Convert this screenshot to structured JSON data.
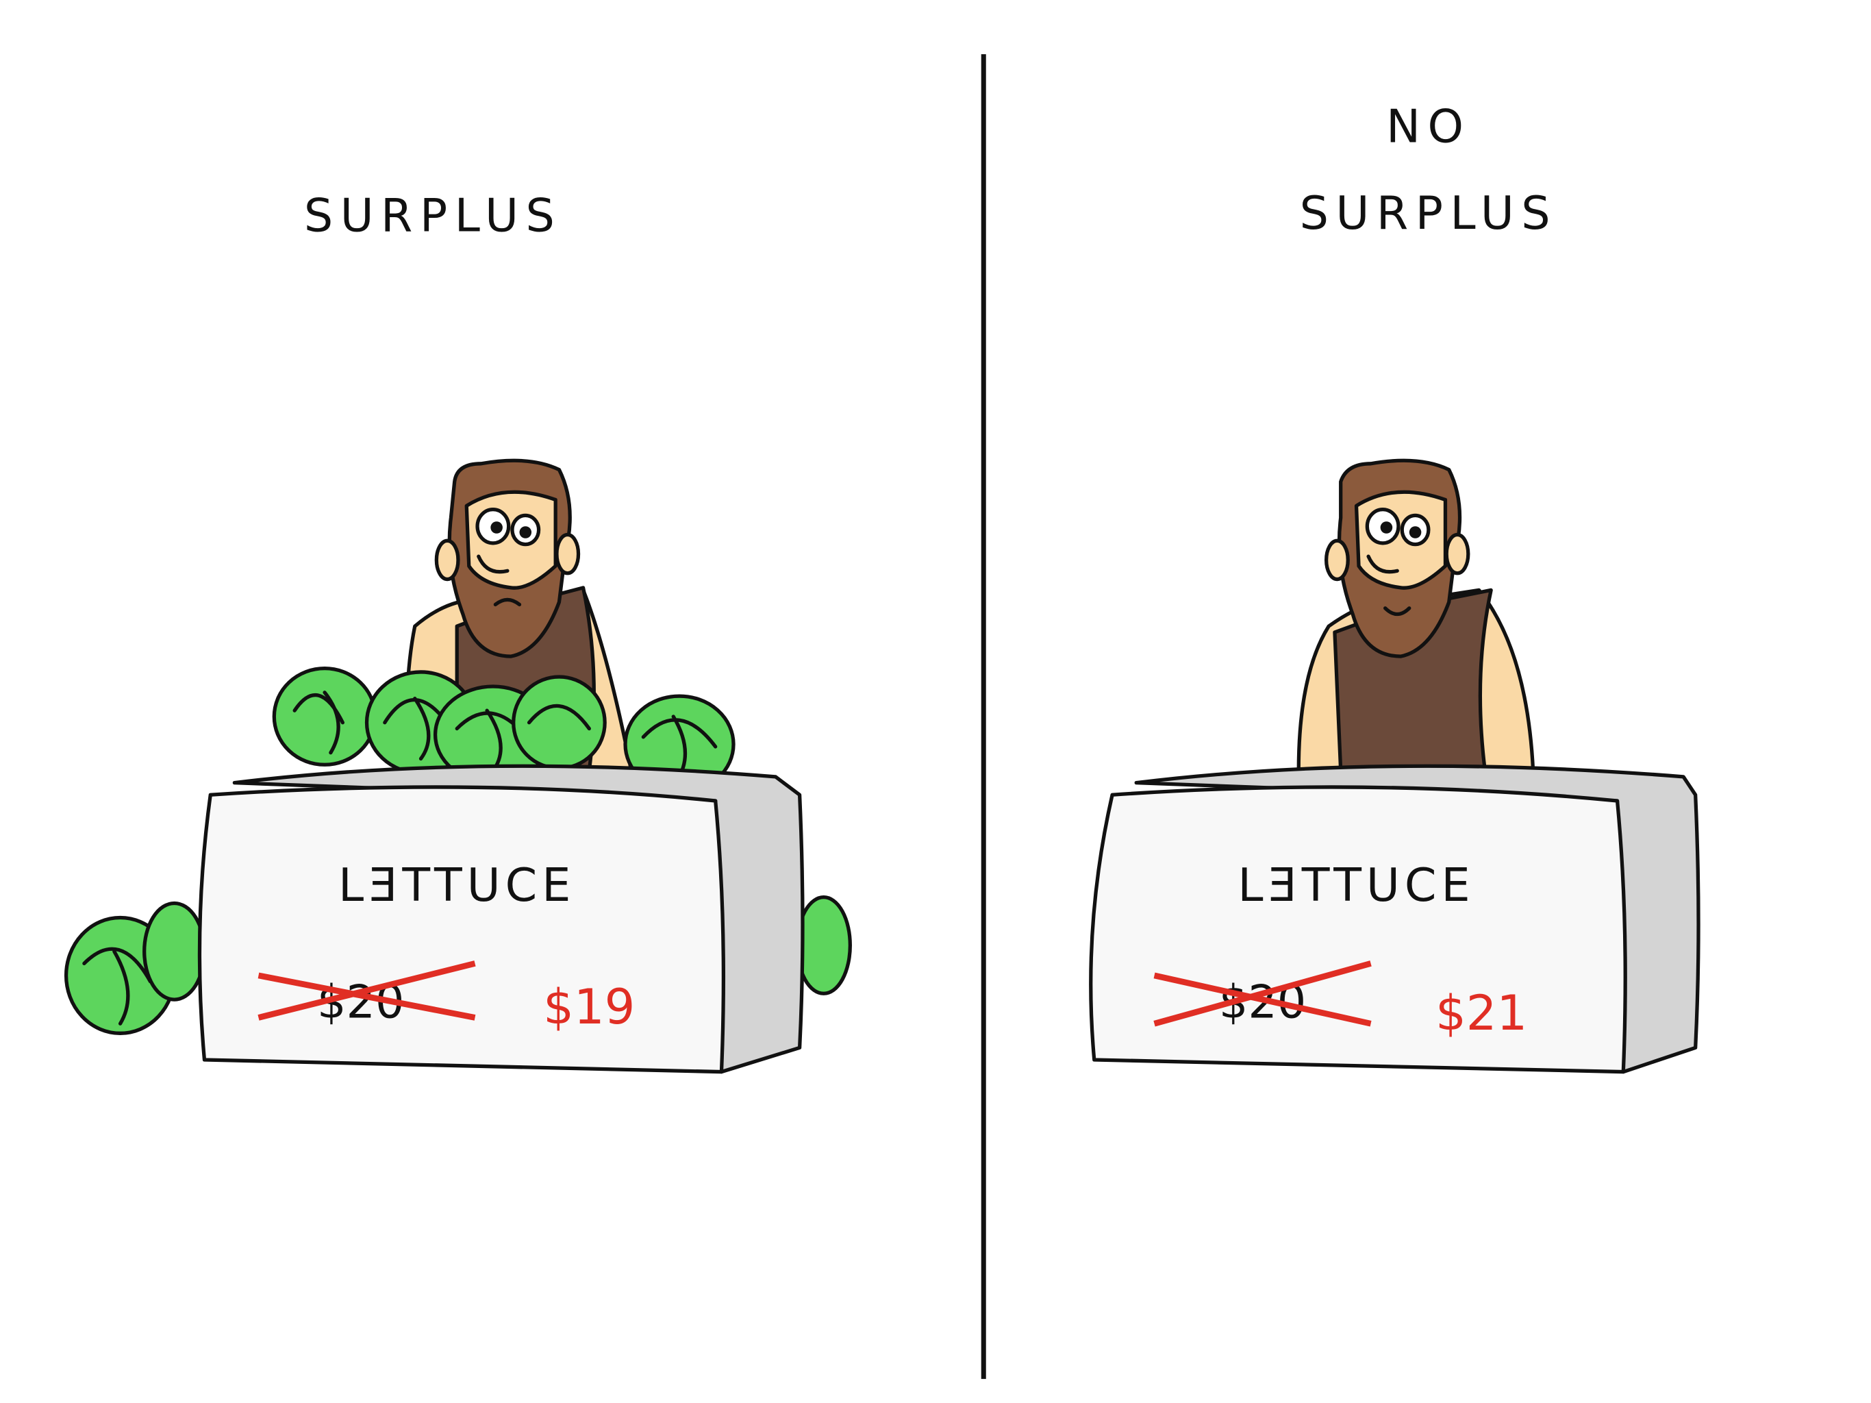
{
  "panels": [
    {
      "title_lines": [
        "SURPLUS"
      ],
      "sign": {
        "word": "LƎTTUCE",
        "old_price": "$20",
        "new_price": "$19"
      },
      "mood": "frown",
      "has_lettuce_pile": true
    },
    {
      "title_lines": [
        "NO",
        "SURPLUS"
      ],
      "sign": {
        "word": "LƎTTUCE",
        "old_price": "$20",
        "new_price": "$21"
      },
      "mood": "smile",
      "has_lettuce_pile": false
    }
  ],
  "colors": {
    "ink": "#111111",
    "price_red": "#e02e24",
    "lettuce": "#5dd55d",
    "lettuce_dark": "#2f9e2f",
    "skin": "#fad9a6",
    "hair": "#8b5a3c",
    "tunic": "#6b4a3a",
    "stand_side": "#d4d4d4",
    "stand_front": "#f8f8f8"
  },
  "icons": [
    "merchant-figure",
    "lettuce-head",
    "crossed-out-price"
  ]
}
